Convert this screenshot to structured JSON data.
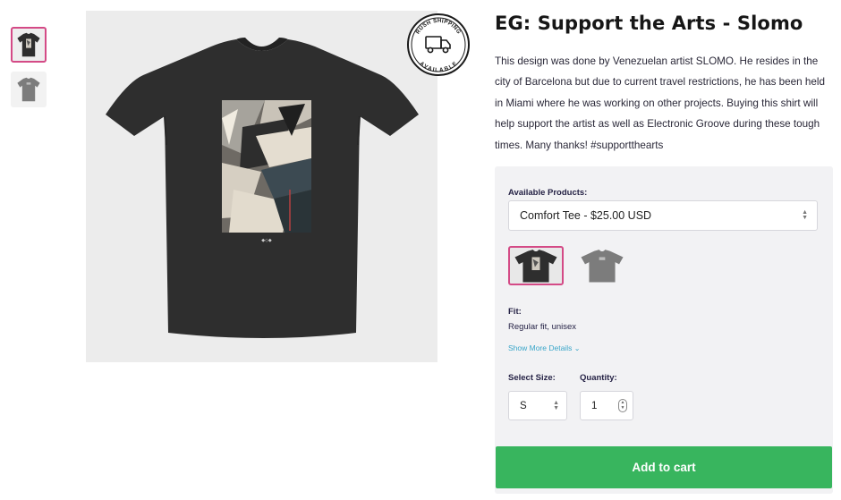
{
  "product": {
    "title": "EG: Support the Arts - Slomo",
    "description": "This design was done by Venezuelan artist SLOMO. He resides in the city of Barcelona but due to current travel restrictions, he has been held in Miami where he was working on other projects. Buying this shirt will help support the artist as well as Electronic Groove during these tough times. Many thanks! #supportthearts"
  },
  "badge": {
    "top_text": "RUSH SHIPPING",
    "bottom_text": "AVAILABLE",
    "icon": "truck-icon"
  },
  "thumbnails": [
    {
      "name": "black-tee",
      "active": true
    },
    {
      "name": "gray-tee",
      "active": false
    }
  ],
  "options": {
    "products_label": "Available Products:",
    "product_selected": "Comfort Tee - $25.00 USD",
    "variants": [
      {
        "color": "#2e2e2e",
        "active": true
      },
      {
        "color": "#7c7c7c",
        "active": false
      }
    ],
    "fit_label": "Fit:",
    "fit_value": "Regular fit, unisex",
    "more_details": "Show More Details",
    "size_label": "Select Size:",
    "size_value": "S",
    "quantity_label": "Quantity:",
    "quantity_value": "1",
    "add_to_cart": "Add to cart"
  },
  "colors": {
    "accent_pink": "#d44a86",
    "cart_green": "#38b55e",
    "link_blue": "#3aa6c9",
    "shirt_black": "#2e2e2e",
    "shirt_gray": "#7c7c7c"
  }
}
